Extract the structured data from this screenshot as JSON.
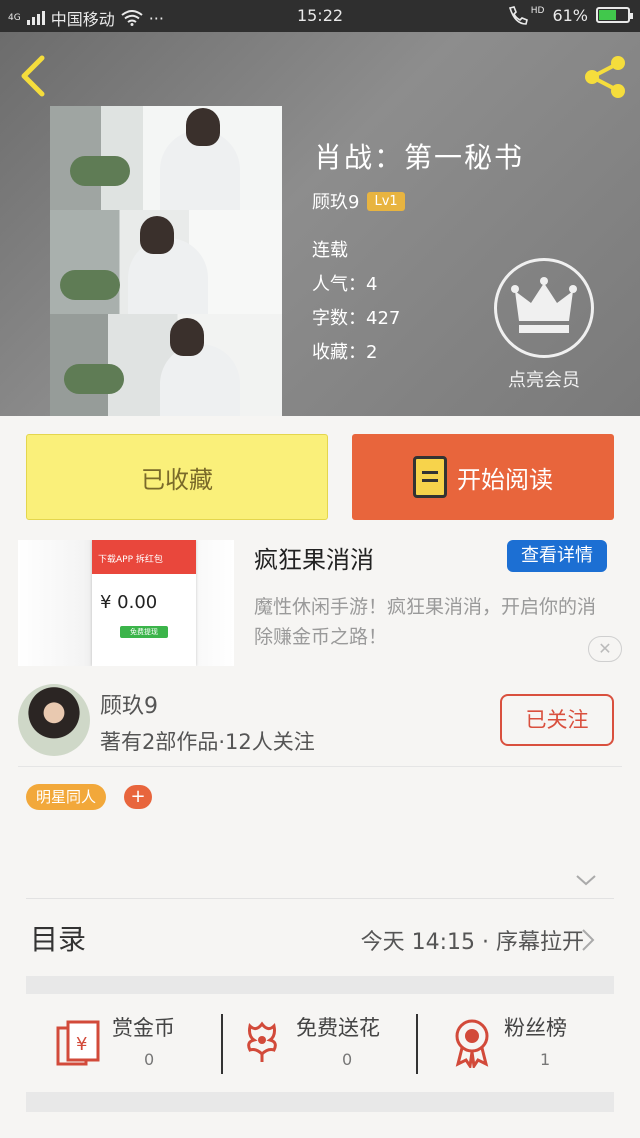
{
  "status_bar": {
    "network": "4G",
    "carrier": "中国移动",
    "more": "···",
    "time": "15:22",
    "hd": "HD",
    "battery": "61%",
    "battery_level": 0.61
  },
  "book": {
    "title": "肖战：第一秘书",
    "author": "顾玖9",
    "level": "Lv1",
    "status": "连载",
    "popularity": "人气：4",
    "words": "字数：427",
    "favorites": "收藏：2"
  },
  "vip": {
    "label": "点亮会员"
  },
  "actions": {
    "collect_label": "已收藏",
    "read_label": "开始阅读"
  },
  "ad": {
    "title": "疯狂果消消",
    "detail_label": "查看详情",
    "description": "魔性休闲手游！疯狂果消消，开启你的消除赚金币之路！",
    "close": "✕",
    "image_amount": "¥ 0.00",
    "image_banner": "下载APP 拆红包",
    "image_button": "免费提现"
  },
  "author_card": {
    "name": "顾玖9",
    "stats": "著有2部作品·12人关注",
    "follow_label": "已关注"
  },
  "tags": {
    "items": [
      "明星同人"
    ],
    "add": "+"
  },
  "toc": {
    "title": "目录",
    "latest": "今天 14:15 · 序幕拉开"
  },
  "rewards": [
    {
      "label": "赏金币",
      "count": "0",
      "icon": "red-envelope-icon"
    },
    {
      "label": "免费送花",
      "count": "0",
      "icon": "flower-icon"
    },
    {
      "label": "粉丝榜",
      "count": "1",
      "icon": "medal-icon"
    }
  ],
  "colors": {
    "accent_orange": "#e8653c",
    "collect_yellow": "#faf07a",
    "tag_orange": "#f2a83a",
    "link_blue": "#1c6fd3",
    "back_yellow": "#f5dd3c"
  }
}
